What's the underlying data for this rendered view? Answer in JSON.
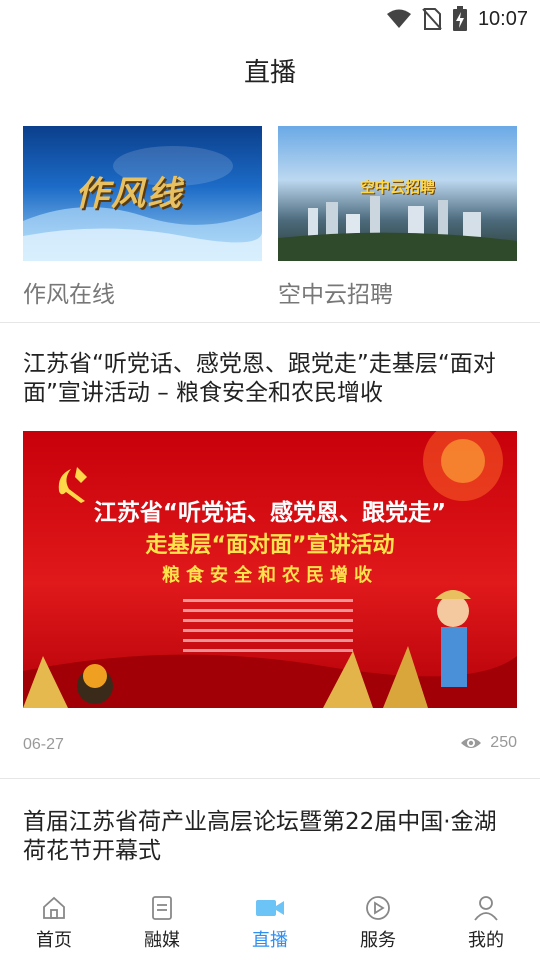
{
  "status": {
    "time": "10:07"
  },
  "header": {
    "title": "直播"
  },
  "live_cards": [
    {
      "label": "作风在线",
      "thumb_text": "作风线"
    },
    {
      "label": "空中云招聘",
      "thumb_text": "空中云招聘"
    }
  ],
  "article1": {
    "title": "江苏省“听党话、感党恩、跟党走”走基层“面对面”宣讲活动 – 粮食安全和农民增收",
    "poster": {
      "line1": "江苏省“听党话、感党恩、跟党走”",
      "line2": "走基层“面对面”宣讲活动",
      "line3": "粮食安全和农民增收"
    },
    "date": "06-27",
    "views": "250"
  },
  "article2": {
    "title": "首届江苏省荷产业高层论坛暨第22届中国·金湖荷花节开幕式"
  },
  "tabs": [
    {
      "label": "首页",
      "icon": "home-icon",
      "active": false
    },
    {
      "label": "融媒",
      "icon": "document-icon",
      "active": false
    },
    {
      "label": "直播",
      "icon": "video-camera-icon",
      "active": true
    },
    {
      "label": "服务",
      "icon": "play-circle-icon",
      "active": false
    },
    {
      "label": "我的",
      "icon": "user-icon",
      "active": false
    }
  ],
  "colors": {
    "accent": "#2f8ff0",
    "poster_red": "#d9161b",
    "poster_yellow": "#ffe34d"
  }
}
